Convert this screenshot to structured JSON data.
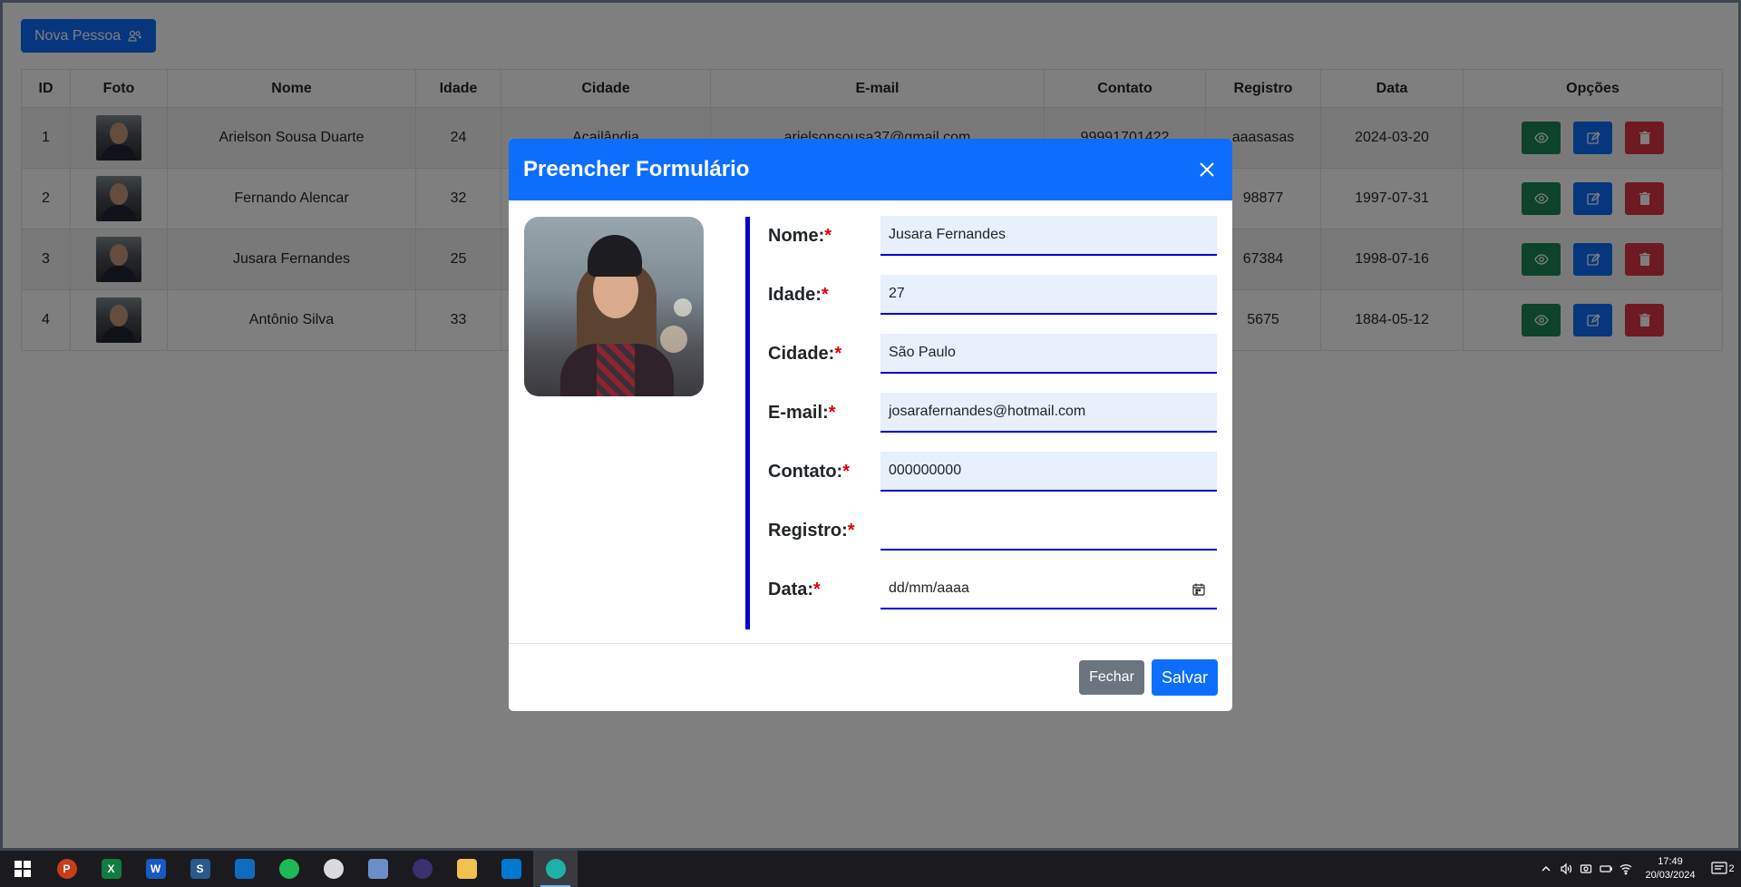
{
  "page": {
    "new_person_label": "Nova Pessoa"
  },
  "table": {
    "headers": [
      "ID",
      "Foto",
      "Nome",
      "Idade",
      "Cidade",
      "E-mail",
      "Contato",
      "Registro",
      "Data",
      "Opções"
    ],
    "rows": [
      {
        "id": "1",
        "nome": "Arielson Sousa Duarte",
        "idade": "24",
        "cidade": "Açailândia",
        "email": "arielsonsousa37@gmail.com",
        "contato": "99991701422",
        "registro": "aaasasas",
        "data": "2024-03-20"
      },
      {
        "id": "2",
        "nome": "Fernando Alencar",
        "idade": "32",
        "cidade": "",
        "email": "",
        "contato": "",
        "registro": "98877",
        "data": "1997-07-31"
      },
      {
        "id": "3",
        "nome": "Jusara Fernandes",
        "idade": "25",
        "cidade": "",
        "email": "",
        "contato": "",
        "registro": "67384",
        "data": "1998-07-16"
      },
      {
        "id": "4",
        "nome": "Antônio Silva",
        "idade": "33",
        "cidade": "",
        "email": "",
        "contato": "",
        "registro": "5675",
        "data": "1884-05-12"
      }
    ]
  },
  "modal": {
    "title": "Preencher Formulário",
    "required_mark": "*",
    "fields": [
      {
        "label": "Nome:",
        "value": "Jusara Fernandes"
      },
      {
        "label": "Idade:",
        "value": "27"
      },
      {
        "label": "Cidade:",
        "value": "São Paulo"
      },
      {
        "label": "E-mail:",
        "value": "josarafernandes@hotmail.com"
      },
      {
        "label": "Contato:",
        "value": "000000000"
      },
      {
        "label": "Registro:",
        "value": ""
      },
      {
        "label": "Data:",
        "value": "dd/mm/aaaa"
      }
    ],
    "close_label": "Fechar",
    "save_label": "Salvar"
  },
  "taskbar": {
    "time": "17:49",
    "date": "20/03/2024",
    "notification_count": "2",
    "apps": [
      "start-icon",
      "powerpoint-icon",
      "excel-icon",
      "word-icon",
      "sql-tool-icon",
      "store-icon",
      "spotify-icon",
      "cloud-app-icon",
      "network-app-icon",
      "eclipse-icon",
      "file-explorer-icon",
      "vscode-icon",
      "edge-icon"
    ]
  },
  "colors": {
    "primary": "#0d6efd",
    "success": "#198754",
    "danger": "#dc3545",
    "secondary": "#6c757d",
    "accent_border": "#0000cc"
  }
}
